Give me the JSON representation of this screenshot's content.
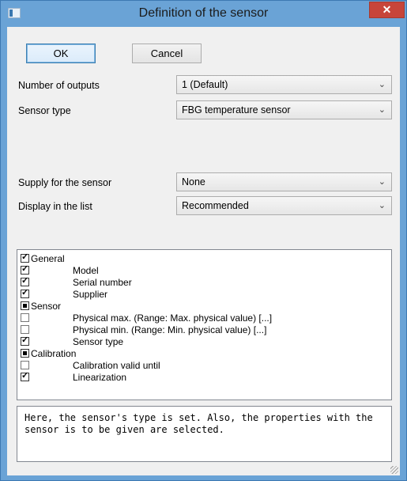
{
  "window": {
    "title": "Definition of the sensor",
    "close_glyph": "✕"
  },
  "buttons": {
    "ok": "OK",
    "cancel": "Cancel"
  },
  "fields": [
    {
      "label": "Number of outputs",
      "value": "1 (Default)"
    },
    {
      "label": "Sensor type",
      "value": "FBG temperature sensor"
    },
    {
      "label": "Supply for the sensor",
      "value": "None"
    },
    {
      "label": "Display in the list",
      "value": "Recommended"
    }
  ],
  "tree": [
    {
      "label": "General",
      "state": "checked",
      "level": 0
    },
    {
      "label": "Model",
      "state": "checked",
      "level": 1
    },
    {
      "label": "Serial number",
      "state": "checked",
      "level": 1
    },
    {
      "label": "Supplier",
      "state": "checked",
      "level": 1
    },
    {
      "label": "Sensor",
      "state": "partial",
      "level": 0
    },
    {
      "label": "Physical max.   (Range: Max. physical value) [...]",
      "state": "unchecked",
      "level": 1
    },
    {
      "label": "Physical min.   (Range: Min. physical value) [...]",
      "state": "unchecked",
      "level": 1
    },
    {
      "label": "Sensor type",
      "state": "checked",
      "level": 1
    },
    {
      "label": "Calibration",
      "state": "partial",
      "level": 0
    },
    {
      "label": "Calibration valid until",
      "state": "unchecked",
      "level": 1
    },
    {
      "label": "Linearization",
      "state": "checked",
      "level": 1
    }
  ],
  "help_text": "Here, the sensor's type is set. Also, the properties with the sensor is to be given are selected.",
  "colors": {
    "titlebar": "#6aa3d6",
    "close": "#c7453a",
    "client": "#f0f0f0"
  }
}
